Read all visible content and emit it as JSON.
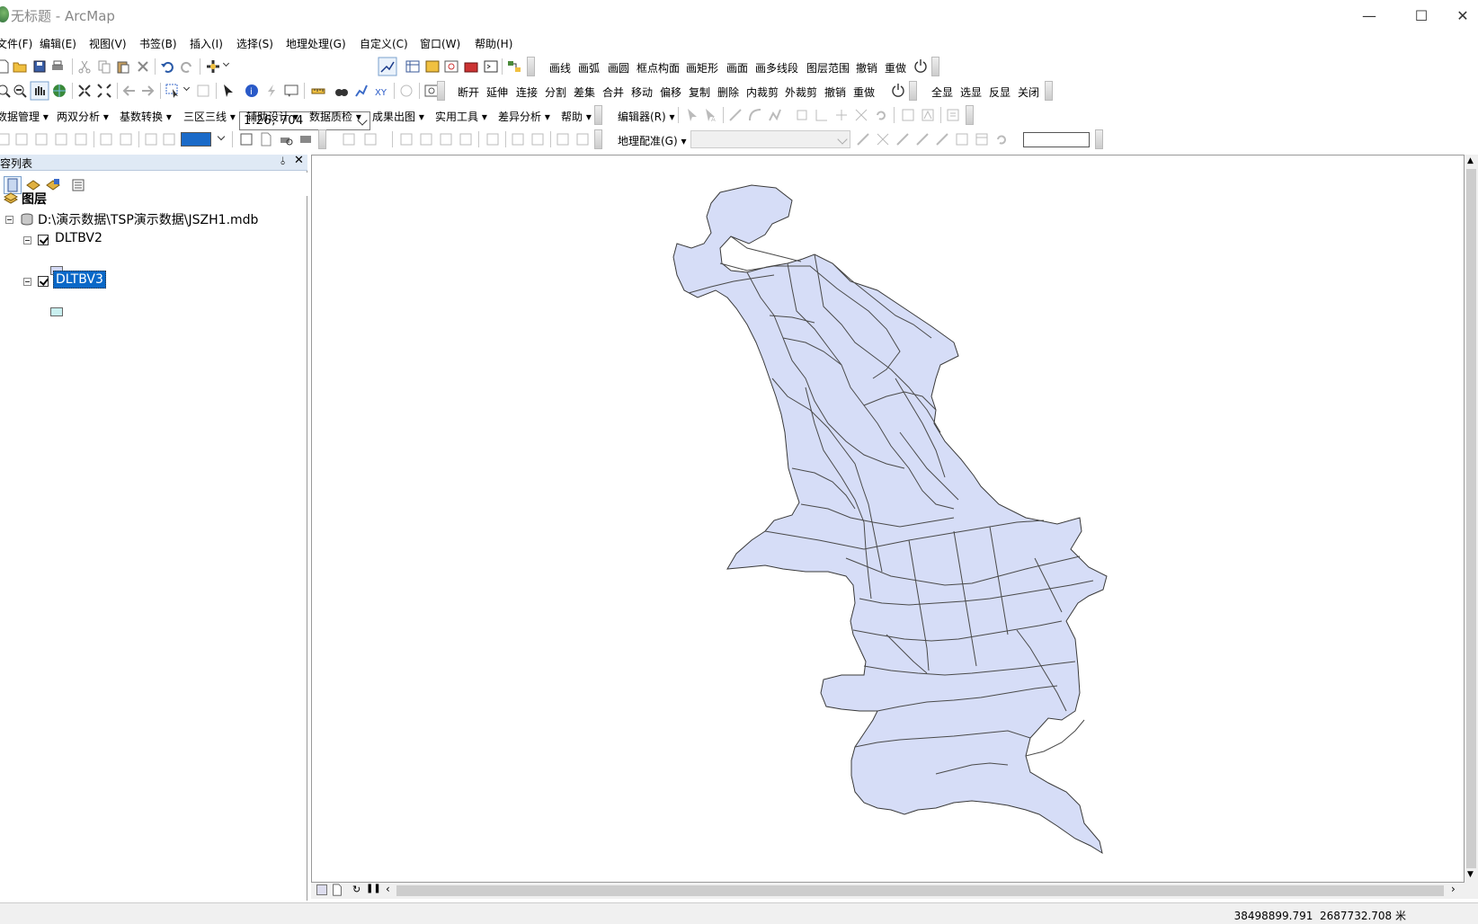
{
  "window": {
    "title": "无标题 - ArcMap"
  },
  "menu": [
    "文件(F)",
    "编辑(E)",
    "视图(V)",
    "书签(B)",
    "插入(I)",
    "选择(S)",
    "地理处理(G)",
    "自定义(C)",
    "窗口(W)",
    "帮助(H)"
  ],
  "toolbar1": {
    "scale": "1:26, 704",
    "tools": [
      "画线",
      "画弧",
      "画圆",
      "框点构面",
      "画矩形",
      "画面",
      "画多线段",
      "图层范围",
      "撤销",
      "重做"
    ]
  },
  "toolbar2": {
    "tools": [
      "断开",
      "延伸",
      "连接",
      "分割",
      "差集",
      "合并",
      "移动",
      "偏移",
      "复制",
      "删除",
      "内裁剪",
      "外裁剪",
      "撤销",
      "重做"
    ],
    "tools2": [
      "全显",
      "选显",
      "反显",
      "关闭"
    ]
  },
  "toolbar3": {
    "menus": [
      "数据管理",
      "两双分析",
      "基数转换",
      "三区三线",
      "辅助设计",
      "数据质检",
      "成果出图",
      "实用工具",
      "差异分析",
      "帮助"
    ],
    "editor": "编辑器(R)"
  },
  "toolbar4": {
    "georef": "地理配准(G)"
  },
  "toc": {
    "title": "容列表",
    "root": "图层",
    "database": "D:\\演示数据\\TSP演示数据\\JSZH1.mdb",
    "layers": [
      {
        "name": "DLTBV2",
        "color": "#d3d9f5"
      },
      {
        "name": "DLTBV3",
        "color": "#c9f0f0"
      }
    ]
  },
  "status": {
    "x": "38498899.791",
    "y": "2687732.708 米"
  },
  "colors": {
    "fill": "#d6ddf7",
    "outline": "#3a3a3a",
    "selected": "#0a68c8"
  }
}
